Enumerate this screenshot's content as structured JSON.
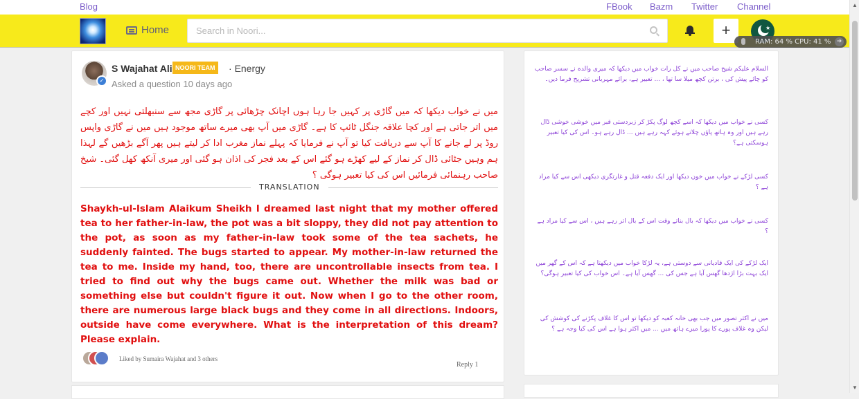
{
  "topbar": {
    "blog": "Blog",
    "fbook": "FBook",
    "bazm": "Bazm",
    "twitter": "Twitter",
    "channel": "Channel"
  },
  "navbar": {
    "home": "Home",
    "search_placeholder": "Search in Noori...",
    "plus": "+"
  },
  "sysmon": {
    "text": "RAM: 64 %  CPU: 41 %"
  },
  "post": {
    "author": "S Wajahat Ali",
    "badge": "NOORI TEAM",
    "topic": "Energy",
    "meta": "Asked a question 10 days ago",
    "urdu": "میں نے خواب دیکھا کہ میں گاڑی پر کہیں جا رہا ہوں اچانک چڑھائی پر گاڑی مجھ سے سنبھلتی نہیں اور کچے میں اتر جاتی ہے اور کچا علاقہ جنگل ٹائپ کا ہے۔ گاڑی میں آپ بھی میرے ساتھ موجود ہیں میں نے گاڑی واپس روڈ پر لے جانے کا آپ سے دریافت کیا تو آپ نے فرمایا کہ پہلے نماز مغرب ادا کر لیتے ہیں پھر آگے بڑھیں گے لہذا ہم وہیں جٹائی ڈال کر نماز کے لیے کھڑے ہو گئے اس کے بعد فجر کی اذان ہو گئی اور میری آنکھ کھل گئی۔ شیخ صاحب رہنمائی فرمائیں اس کی کیا تعبیر ہوگی ؟",
    "translation_label": "TRANSLATION",
    "english": "Shaykh-ul-Islam Alaikum Sheikh I dreamed last night that my mother offered tea to her father-in-law, the pot was a bit sloppy, they did not pay attention to the pot, as soon as my father-in-law took some of the tea sachets, he suddenly fainted. The bugs started to appear. My mother-in-law returned the tea to me. Inside my hand, too, there are uncontrollable insects from tea. I tried to find out why the bugs came out. Whether the milk was bad or something else but couldn't figure it out. Now when I go to the other room, there are numerous large black bugs and they come in all directions. Indoors, outside have come everywhere. What is the interpretation of this dream? Please explain.",
    "liked_by": "Liked by Sumaira Wajahat and 3 others",
    "reply": "Reply 1"
  },
  "sidebar": {
    "questions": [
      "السلام علیکم شیخ صاحب میں نے کل رات خواب میں دیکھا کہ میری والدہ نے سسر صاحب کو چائے پیش کی ، برتن کچھ میلا سا تھا ، ... تعبیر ہے، برائے مہربانی تشریح فرما دیں۔",
      "کسی نے خواب میں دیکھا کہ اسے کچھ لوگ پکڑ کر زبردستی قبر میں خوشی خوشی ڈال رہے ہیں اور وہ ہاتھ پاؤں چلاتے ہوئے کہہ رہے ہیں ... ڈال رہے ہو۔ اس کی کیا تعبیر ہوسکتی ہے؟",
      "کسی لڑکے نے خواب میں خون دیکھا اور ایک دفعہ قتل و غارتگری دیکھی اس سے کیا مراد ہے ؟",
      "کسی نے خواب میں دیکھا کہ بال بناتے وقت اس کے بال اتر رہے ہیں ، اس سے کیا مراد ہے ؟",
      "ایک لڑکے کی ایک قادیانی سے دوستی ہے، یہ لڑکا خواب میں دیکھتا ہے کہ اس کے گھر میں ایک بہت بڑا اژدھا گھس آیا ہے جس کی ... گھس آیا ہے۔ اس خواب کی کیا تعبیر ہوگی؟",
      "میں نے اکثر تصور میں جب بھی خانہ کعبہ کو دیکھا تو اس کا غلاف پکڑنے کی کوشش کی لیکن وہ غلاف پورے کا پورا میرے ہاتھ میں ... میں اکثر ہوا ہے اس کی کیا وجہ ہے ؟"
    ]
  },
  "colors": {
    "navbar": "#f7ea1b",
    "link": "#7b5cc9",
    "question_red": "#e10f0f",
    "sidebar_purple": "#8e44d8",
    "badge": "#f5b819"
  }
}
